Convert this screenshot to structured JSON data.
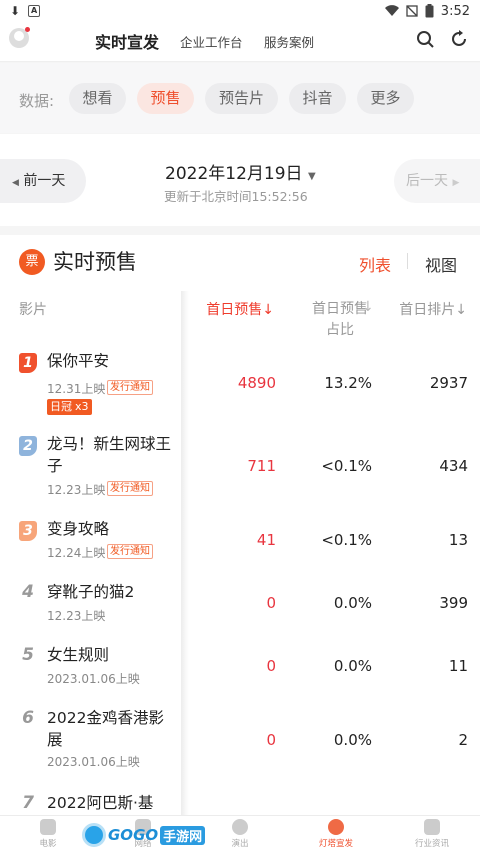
{
  "status_bar": {
    "time": "3:52"
  },
  "top_nav": {
    "tab_active": "实时宣发",
    "tab_workbench": "企业工作台",
    "tab_cases": "服务案例"
  },
  "data_bar": {
    "label": "数据:",
    "chips": [
      "想看",
      "预售",
      "预告片",
      "抖音",
      "更多"
    ],
    "active_chip": "预售"
  },
  "date_bar": {
    "prev": "前一天",
    "date": "2022年12月19日",
    "updated": "更新于北京时间15:52:56",
    "next": "后一天"
  },
  "panel": {
    "icon_glyph": "票",
    "title": "实时预售",
    "view_list": "列表",
    "view_chart": "视图",
    "headers": {
      "film": "影片",
      "first_day_presale": "首日预售",
      "presale_share": "首日预售占比",
      "schedule": "首日排片"
    },
    "rows": [
      {
        "rank": "1",
        "name": "保你平安",
        "date": "12.31上映",
        "notice": "发行通知",
        "crown": "日冠",
        "crown_count": "x3",
        "presale": "4890",
        "share": "13.2%",
        "schedule": "2937"
      },
      {
        "rank": "2",
        "name": "龙马！新生网球王子",
        "date": "12.23上映",
        "notice": "发行通知",
        "presale": "711",
        "share": "<0.1%",
        "schedule": "434"
      },
      {
        "rank": "3",
        "name": "变身攻略",
        "date": "12.24上映",
        "notice": "发行通知",
        "presale": "41",
        "share": "<0.1%",
        "schedule": "13"
      },
      {
        "rank": "4",
        "name": "穿靴子的猫2",
        "date": "12.23上映",
        "presale": "0",
        "share": "0.0%",
        "schedule": "399"
      },
      {
        "rank": "5",
        "name": "女生规则",
        "date": "2023.01.06上映",
        "presale": "0",
        "share": "0.0%",
        "schedule": "11"
      },
      {
        "rank": "6",
        "name": "2022金鸡香港影展",
        "date": "2023.01.06上映",
        "presale": "0",
        "share": "0.0%",
        "schedule": "2"
      },
      {
        "rank": "7",
        "name": "2022阿巴斯·基"
      }
    ]
  },
  "bottom_nav": [
    "电影",
    "网络",
    "演出",
    "灯塔宣发",
    "行业资讯"
  ],
  "bottom_nav_active": "灯塔宣发",
  "watermark": {
    "brand": "GOGO",
    "suffix": "手游网"
  },
  "colors": {
    "accent": "#ef4f2d",
    "value_red": "#e8353f",
    "rank1": "#f0512d",
    "rank2": "#8fb4dc",
    "rank3": "#f7a57a"
  }
}
